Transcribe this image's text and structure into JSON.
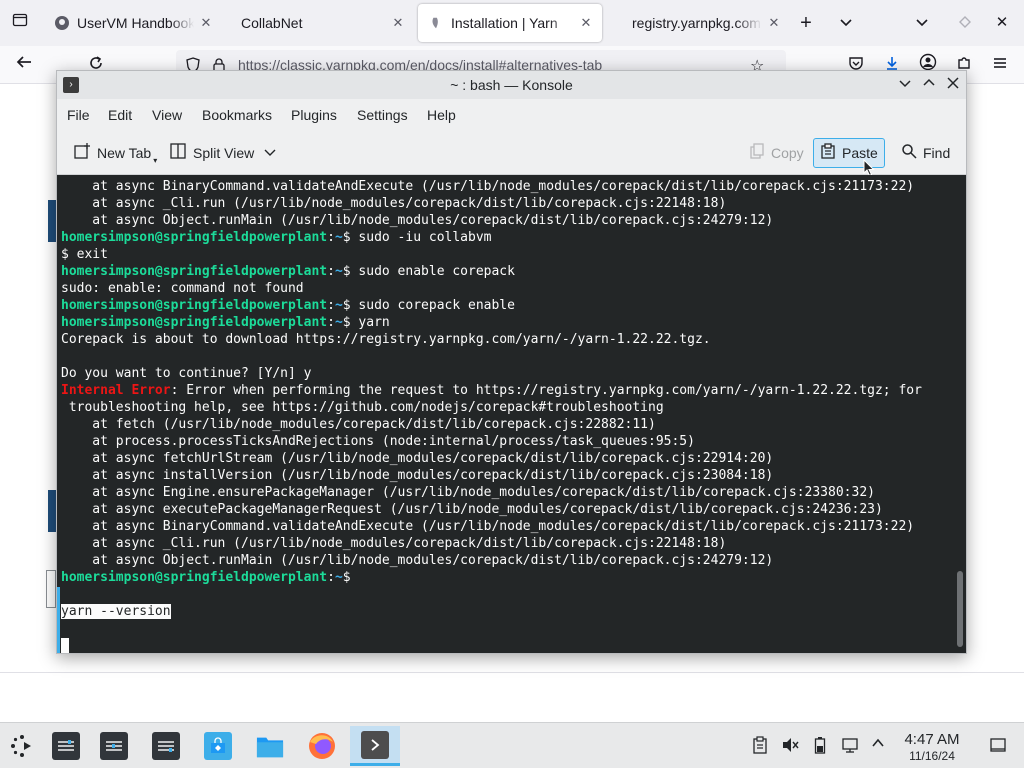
{
  "browser": {
    "tabs": [
      {
        "title": "UserVM Handbook",
        "icon": "github-icon"
      },
      {
        "title": "CollabNet",
        "icon": "none"
      },
      {
        "title": "Installation | Yarn",
        "icon": "yarn-icon"
      },
      {
        "title": "registry.yarnpkg.com",
        "icon": "none"
      }
    ],
    "url": "https://classic.yarnpkg.com/en/docs/install#alternatives-tab",
    "new_tab_glyph": "+"
  },
  "konsole": {
    "title": "~ : bash — Konsole",
    "menus": [
      "File",
      "Edit",
      "View",
      "Bookmarks",
      "Plugins",
      "Settings",
      "Help"
    ],
    "toolbar": {
      "new_tab": "New Tab",
      "split_view": "Split View",
      "copy": "Copy",
      "paste": "Paste",
      "find": "Find"
    },
    "terminal": {
      "prompt_user": "homersimpson@springfieldpowerplant",
      "prompt_path": "~",
      "prompt_sym": "$ ",
      "lines": [
        {
          "kind": "plain",
          "text": "    at async BinaryCommand.validateAndExecute (/usr/lib/node_modules/corepack/dist/lib/corepack.cjs:21173:22)"
        },
        {
          "kind": "plain",
          "text": "    at async _Cli.run (/usr/lib/node_modules/corepack/dist/lib/corepack.cjs:22148:18)"
        },
        {
          "kind": "plain",
          "text": "    at async Object.runMain (/usr/lib/node_modules/corepack/dist/lib/corepack.cjs:24279:12)"
        },
        {
          "kind": "prompt",
          "text": "sudo -iu collabvm"
        },
        {
          "kind": "plain",
          "text": "$ exit"
        },
        {
          "kind": "prompt",
          "text": "sudo enable corepack"
        },
        {
          "kind": "plain",
          "text": "sudo: enable: command not found"
        },
        {
          "kind": "prompt",
          "text": "sudo corepack enable"
        },
        {
          "kind": "prompt",
          "text": "yarn"
        },
        {
          "kind": "plain",
          "text": "Corepack is about to download https://registry.yarnpkg.com/yarn/-/yarn-1.22.22.tgz."
        },
        {
          "kind": "plain",
          "text": ""
        },
        {
          "kind": "plain",
          "text": "Do you want to continue? [Y/n] y"
        },
        {
          "kind": "error",
          "label": "Internal Error",
          "text": ": Error when performing the request to https://registry.yarnpkg.com/yarn/-/yarn-1.22.22.tgz; for"
        },
        {
          "kind": "plain",
          "text": " troubleshooting help, see https://github.com/nodejs/corepack#troubleshooting"
        },
        {
          "kind": "plain",
          "text": "    at fetch (/usr/lib/node_modules/corepack/dist/lib/corepack.cjs:22882:11)"
        },
        {
          "kind": "plain",
          "text": "    at process.processTicksAndRejections (node:internal/process/task_queues:95:5)"
        },
        {
          "kind": "plain",
          "text": "    at async fetchUrlStream (/usr/lib/node_modules/corepack/dist/lib/corepack.cjs:22914:20)"
        },
        {
          "kind": "plain",
          "text": "    at async installVersion (/usr/lib/node_modules/corepack/dist/lib/corepack.cjs:23084:18)"
        },
        {
          "kind": "plain",
          "text": "    at async Engine.ensurePackageManager (/usr/lib/node_modules/corepack/dist/lib/corepack.cjs:23380:32)"
        },
        {
          "kind": "plain",
          "text": "    at async executePackageManagerRequest (/usr/lib/node_modules/corepack/dist/lib/corepack.cjs:24236:23)"
        },
        {
          "kind": "plain",
          "text": "    at async BinaryCommand.validateAndExecute (/usr/lib/node_modules/corepack/dist/lib/corepack.cjs:21173:22)"
        },
        {
          "kind": "plain",
          "text": "    at async _Cli.run (/usr/lib/node_modules/corepack/dist/lib/corepack.cjs:22148:18)"
        },
        {
          "kind": "plain",
          "text": "    at async Object.runMain (/usr/lib/node_modules/corepack/dist/lib/corepack.cjs:24279:12)"
        },
        {
          "kind": "prompt",
          "text": ""
        },
        {
          "kind": "plain",
          "text": ""
        },
        {
          "kind": "selected",
          "text": "yarn --version"
        },
        {
          "kind": "plain",
          "text": ""
        },
        {
          "kind": "cursor",
          "text": ""
        }
      ]
    }
  },
  "taskbar": {
    "clock_time": "4:47 AM",
    "clock_date": "11/16/24"
  },
  "colors": {
    "terminal_bg": "#232627",
    "prompt_user": "#1cdc9a",
    "prompt_path": "#3daee9",
    "error": "#ed1515",
    "accent": "#3daee9"
  }
}
